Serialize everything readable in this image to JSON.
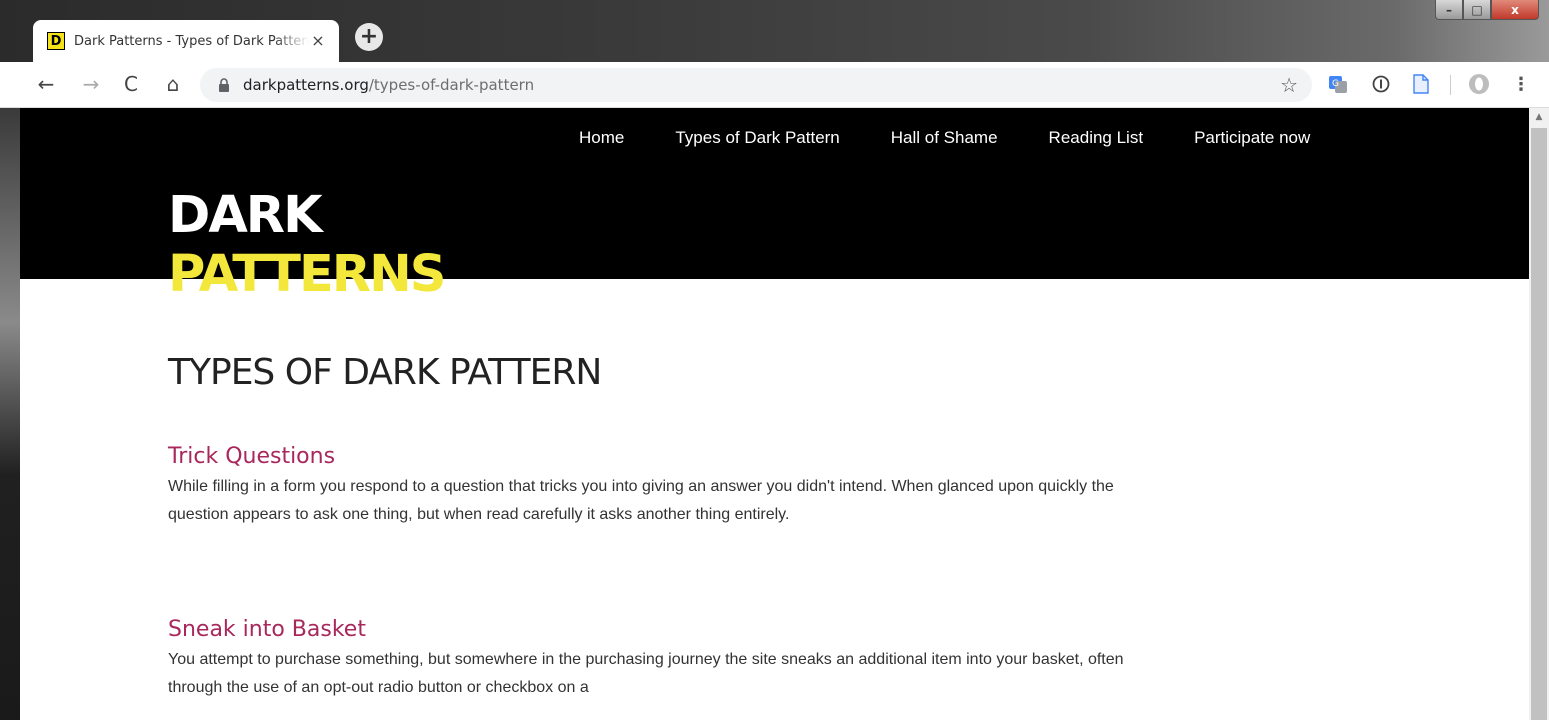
{
  "browser": {
    "tab": {
      "favicon_letter": "D",
      "title": "Dark Patterns - Types of Dark Pattern",
      "close_glyph": "×"
    },
    "new_tab_glyph": "+",
    "window_controls": {
      "minimize": "–",
      "maximize": "□",
      "close": "x"
    },
    "nav": {
      "back": "←",
      "forward": "→",
      "reload": "C",
      "home": "⌂"
    },
    "url": {
      "host": "darkpatterns.org",
      "path": "/types-of-dark-pattern"
    },
    "bookmark_glyph": "☆",
    "menu_glyph": "⋮"
  },
  "site": {
    "nav": [
      "Home",
      "Types of Dark Pattern",
      "Hall of Shame",
      "Reading List",
      "Participate now"
    ],
    "logo": {
      "line1": "DARK",
      "line2": "PATTERNS"
    },
    "page_title": "TYPES OF DARK PATTERN",
    "sections": [
      {
        "title": "Trick Questions",
        "text": "While filling in a form you respond to a question that tricks you into giving an answer you didn't intend. When glanced upon quickly the question appears to ask one thing, but when read carefully it asks another thing entirely."
      },
      {
        "title": "Sneak into Basket",
        "text": "You attempt to purchase something, but somewhere in the purchasing journey the site sneaks an additional item into your basket, often through the use of an opt-out radio button or checkbox on a"
      }
    ],
    "colors": {
      "header_bg": "#000000",
      "logo_accent": "#f2e73a",
      "section_title": "#a8285c"
    }
  }
}
